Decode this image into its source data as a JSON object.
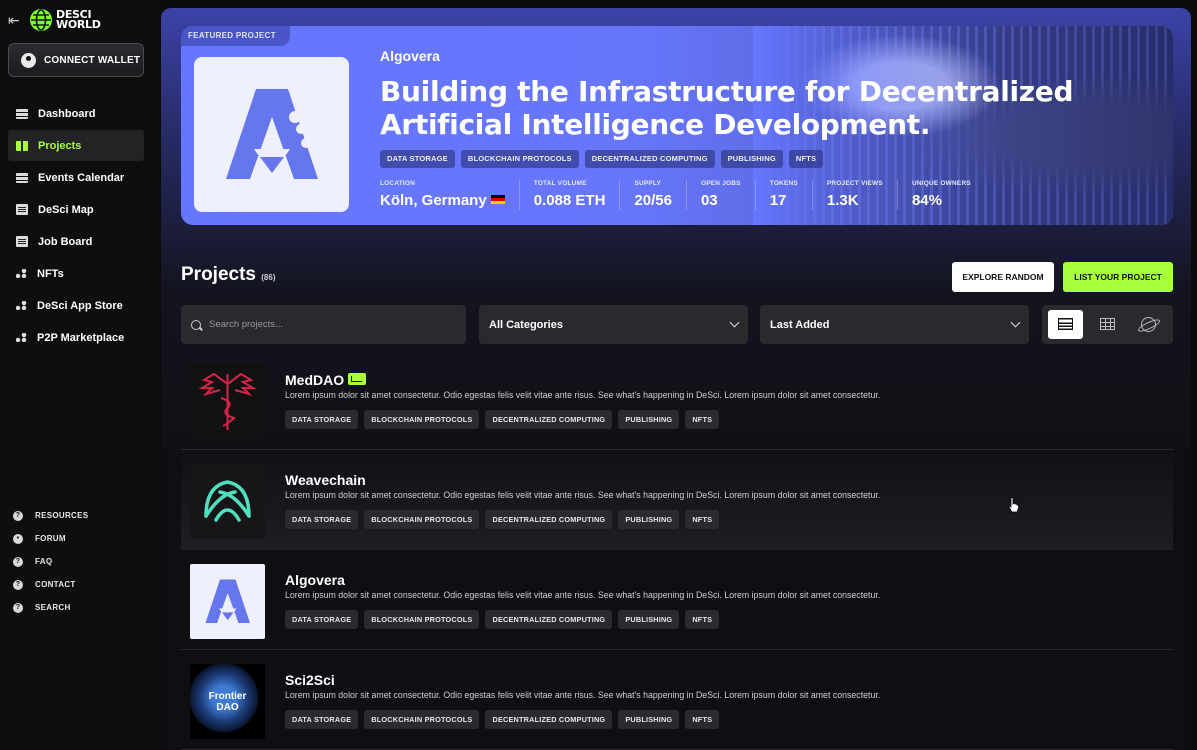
{
  "brand": {
    "line1": "DESCI",
    "line2": "WORLD"
  },
  "wallet": {
    "label": "CONNECT WALLET"
  },
  "nav": [
    {
      "label": "Dashboard",
      "icon": "bars-icon"
    },
    {
      "label": "Projects",
      "icon": "book-icon",
      "active": true
    },
    {
      "label": "Events Calendar",
      "icon": "bars-icon"
    },
    {
      "label": "DeSci Map",
      "icon": "calendar-icon"
    },
    {
      "label": "Job Board",
      "icon": "calendar-icon"
    },
    {
      "label": "NFTs",
      "icon": "nft-icon"
    },
    {
      "label": "DeSci App Store",
      "icon": "nft-icon"
    },
    {
      "label": "P2P Marketplace",
      "icon": "nft-icon"
    }
  ],
  "resources": [
    "RESOURCES",
    "FORUM",
    "FAQ",
    "CONTACT",
    "SEARCH"
  ],
  "featured": {
    "tag": "FEATURED PROJECT",
    "name": "Algovera",
    "title": "Building the Infrastructure for Decentralized Artificial Intelligence Development.",
    "tags": [
      "DATA STORAGE",
      "BLOCKCHAIN PROTOCOLS",
      "DECENTRALIZED COMPUTING",
      "PUBLISHING",
      "NFTS"
    ],
    "stats": [
      {
        "label": "LOCATION",
        "value": "Köln, Germany"
      },
      {
        "label": "TOTAL VOLUME",
        "value": "0.088 ETH"
      },
      {
        "label": "SUPPLY",
        "value": "20/56"
      },
      {
        "label": "OPEN JOBS",
        "value": "03"
      },
      {
        "label": "TOKENS",
        "value": "17"
      },
      {
        "label": "PROJECT VIEWS",
        "value": "1.3K"
      },
      {
        "label": "UNIQUE OWNERS",
        "value": "84%"
      }
    ]
  },
  "projects_header": {
    "title": "Projects",
    "count": "(86)"
  },
  "buttons": {
    "explore": "EXPLORE RANDOM",
    "list": "LIST YOUR PROJECT"
  },
  "filters": {
    "search_placeholder": "Search projects...",
    "category": "All Categories",
    "sort": "Last Added"
  },
  "projects": [
    {
      "name": "MedDAO",
      "desc": "Lorem ipsum dolor sit amet consectetur. Odio egestas felis velit vitae ante risus. See what's happening in DeSci.  Lorem ipsum dolor sit amet consectetur.",
      "tags": [
        "DATA STORAGE",
        "BLOCKCHAIN PROTOCOLS",
        "DECENTRALIZED COMPUTING",
        "PUBLISHING",
        "NFTS"
      ]
    },
    {
      "name": "Weavechain",
      "desc": "Lorem ipsum dolor sit amet consectetur. Odio egestas felis velit vitae ante risus. See what's happening in DeSci.  Lorem ipsum dolor sit amet consectetur.",
      "tags": [
        "DATA STORAGE",
        "BLOCKCHAIN PROTOCOLS",
        "DECENTRALIZED COMPUTING",
        "PUBLISHING",
        "NFTS"
      ]
    },
    {
      "name": "Algovera",
      "desc": "Lorem ipsum dolor sit amet consectetur. Odio egestas felis velit vitae ante risus. See what's happening in DeSci.  Lorem ipsum dolor sit amet consectetur.",
      "tags": [
        "DATA STORAGE",
        "BLOCKCHAIN PROTOCOLS",
        "DECENTRALIZED COMPUTING",
        "PUBLISHING",
        "NFTS"
      ]
    },
    {
      "name": "Sci2Sci",
      "thumb_text": [
        "Frontier",
        "DAO"
      ],
      "desc": "Lorem ipsum dolor sit amet consectetur. Odio egestas felis velit vitae ante risus. See what's happening in DeSci.  Lorem ipsum dolor sit amet consectetur.",
      "tags": [
        "DATA STORAGE",
        "BLOCKCHAIN PROTOCOLS",
        "DECENTRALIZED COMPUTING",
        "PUBLISHING",
        "NFTS"
      ]
    }
  ],
  "colors": {
    "accent": "#a8ff3c",
    "hero": "#6677ff",
    "background": "#0b0b0d"
  }
}
